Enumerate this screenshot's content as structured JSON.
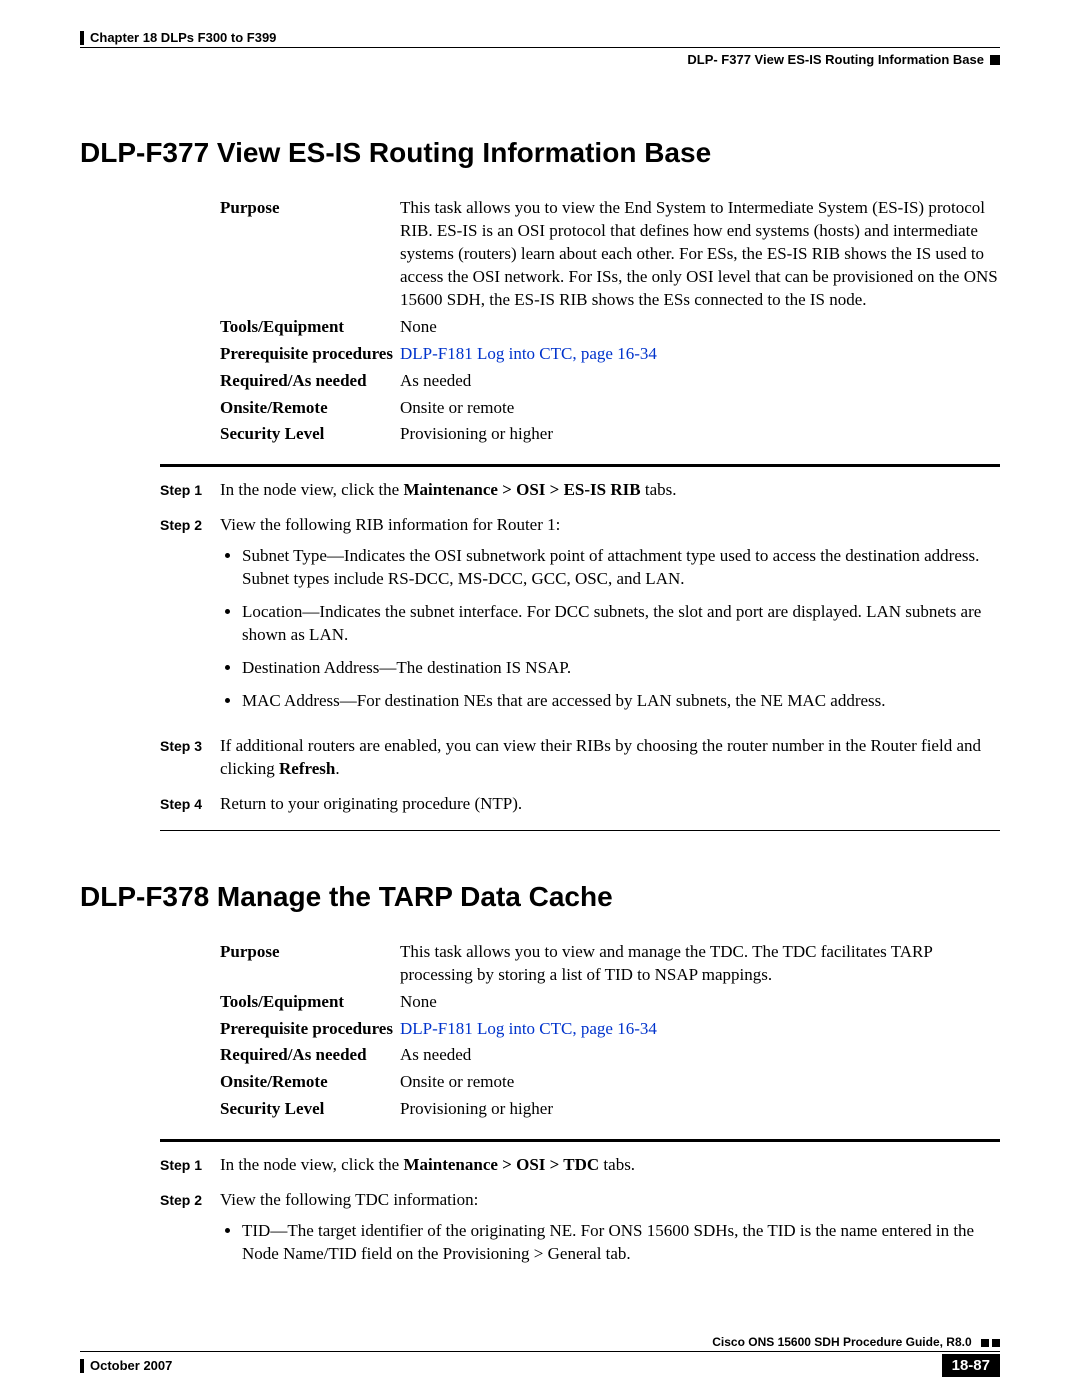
{
  "header": {
    "chapter": "Chapter 18 DLPs F300 to F399",
    "topic": "DLP- F377 View ES-IS Routing Information Base"
  },
  "section1": {
    "title": "DLP-F377 View ES-IS Routing Information Base",
    "meta": {
      "purpose_label": "Purpose",
      "purpose": "This task allows you to view the End System to Intermediate System (ES-IS) protocol RIB. ES-IS is an OSI protocol that defines how end systems (hosts) and intermediate systems (routers) learn about each other. For ESs, the ES-IS RIB shows the IS used to access the OSI network. For ISs, the only OSI level that can be provisioned on the ONS 15600 SDH, the ES-IS RIB shows the ESs connected to the IS node.",
      "tools_label": "Tools/Equipment",
      "tools": "None",
      "prereq_label": "Prerequisite procedures",
      "prereq": "DLP-F181 Log into CTC, page 16-34",
      "required_label": "Required/As needed",
      "required": "As needed",
      "onsite_label": "Onsite/Remote",
      "onsite": "Onsite or remote",
      "security_label": "Security Level",
      "security": "Provisioning or higher"
    },
    "steps": {
      "s1_label": "Step 1",
      "s1_pre": "In the node view, click the ",
      "s1_bold": "Maintenance > OSI > ES-IS RIB",
      "s1_post": " tabs.",
      "s2_label": "Step 2",
      "s2": "View the following RIB information for Router 1:",
      "b1": "Subnet Type—Indicates the OSI subnetwork point of attachment type used to access the destination address. Subnet types include RS-DCC, MS-DCC, GCC, OSC, and LAN.",
      "b2": "Location—Indicates the subnet interface. For DCC subnets, the slot and port are displayed. LAN subnets are shown as LAN.",
      "b3": "Destination Address—The destination IS NSAP.",
      "b4": "MAC Address—For destination NEs that are accessed by LAN subnets, the NE MAC address.",
      "s3_label": "Step 3",
      "s3_pre": "If additional routers are enabled, you can view their RIBs by choosing the router number in the Router field and clicking ",
      "s3_bold": "Refresh",
      "s3_post": ".",
      "s4_label": "Step 4",
      "s4": "Return to your originating procedure (NTP)."
    }
  },
  "section2": {
    "title": "DLP-F378 Manage the TARP Data Cache",
    "meta": {
      "purpose_label": "Purpose",
      "purpose": "This task allows you to view and manage the TDC. The TDC facilitates TARP processing by storing a list of TID to NSAP mappings.",
      "tools_label": "Tools/Equipment",
      "tools": "None",
      "prereq_label": "Prerequisite procedures",
      "prereq": "DLP-F181 Log into CTC, page 16-34",
      "required_label": "Required/As needed",
      "required": "As needed",
      "onsite_label": "Onsite/Remote",
      "onsite": "Onsite or remote",
      "security_label": "Security Level",
      "security": "Provisioning or higher"
    },
    "steps": {
      "s1_label": "Step 1",
      "s1_pre": "In the node view, click the ",
      "s1_bold": "Maintenance > OSI > TDC",
      "s1_post": " tabs.",
      "s2_label": "Step 2",
      "s2": "View the following TDC information:",
      "b1": "TID—The target identifier of the originating NE. For ONS 15600 SDHs, the TID is the name entered in the Node Name/TID field on the Provisioning > General tab."
    }
  },
  "footer": {
    "guide": "Cisco ONS 15600 SDH Procedure Guide, R8.0",
    "date": "October 2007",
    "page": "18-87"
  }
}
